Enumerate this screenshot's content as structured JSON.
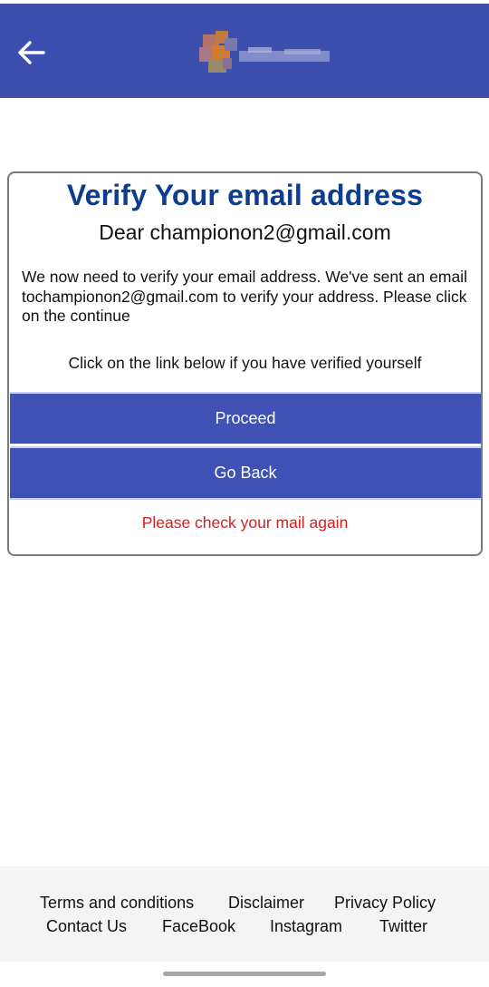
{
  "header": {
    "back_icon": "arrow-left-icon",
    "logo": "blurred-logo",
    "bar_color": "#3d4fae"
  },
  "card": {
    "title": "Verify Your email address",
    "greeting": "Dear championon2@gmail.com",
    "message": "We now need to verify your email address. We've sent an email tochampionon2@gmail.com to verify your address. Please click on the continue",
    "hint": "Click on the link below if you have verified yourself",
    "proceed_label": "Proceed",
    "goback_label": "Go Back",
    "error_text": "Please check your mail again",
    "title_color": "#0b3d91",
    "button_color": "#3f51b5",
    "error_color": "#d32020"
  },
  "footer": {
    "links": [
      "Terms and conditions",
      "Disclaimer",
      "Privacy Policy",
      "Contact Us",
      "FaceBook",
      "Instagram",
      "Twitter"
    ]
  }
}
